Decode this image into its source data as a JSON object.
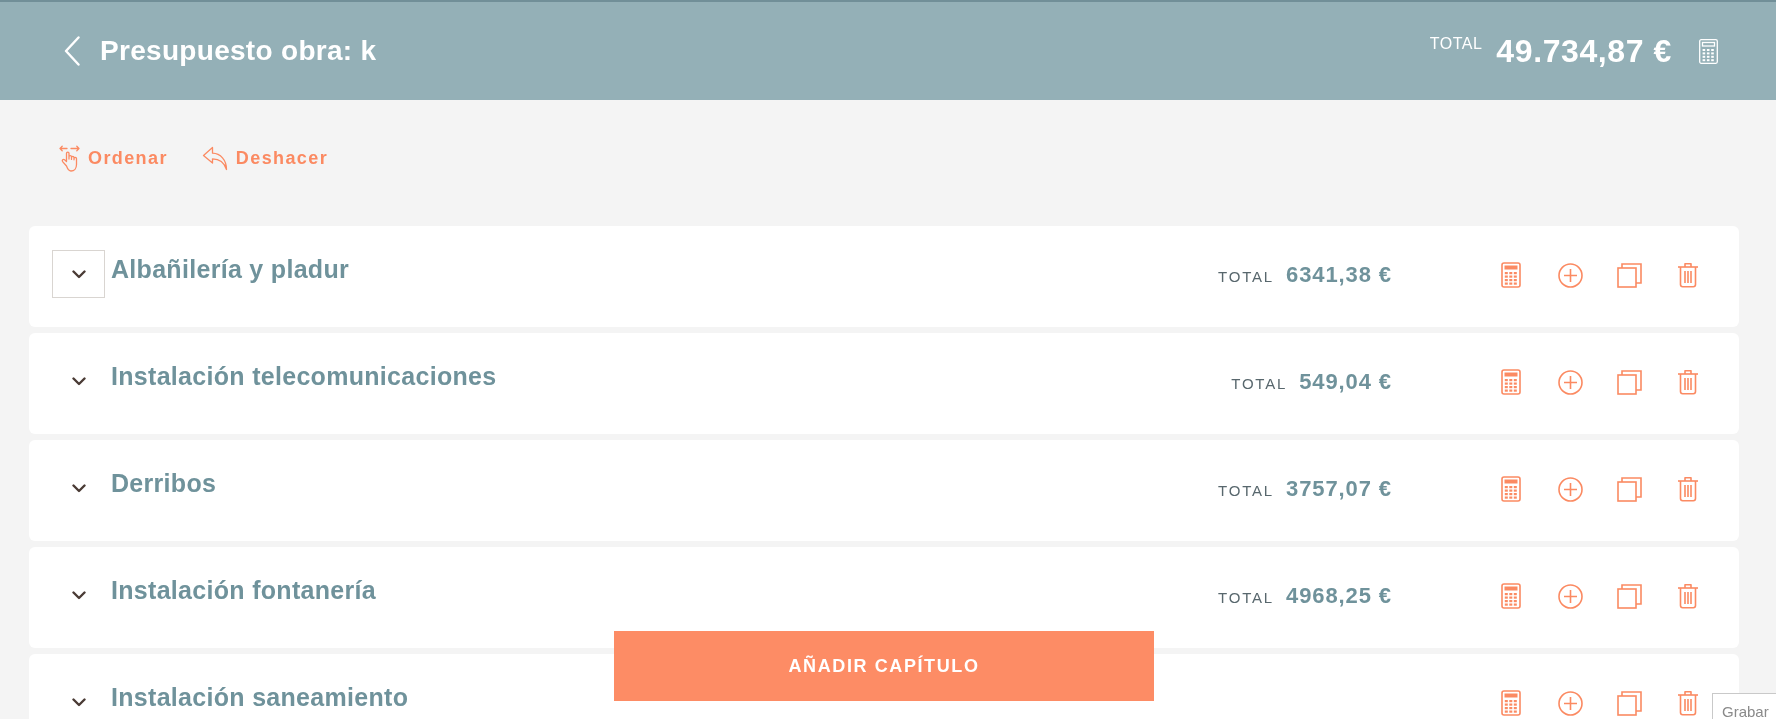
{
  "header": {
    "title": "Presupuesto obra: k",
    "total_label": "TOTAL",
    "total": "49.734,87 €"
  },
  "toolbar": [
    {
      "kind": "sort",
      "label": "Ordenar"
    },
    {
      "kind": "undo",
      "label": "Deshacer"
    }
  ],
  "chapters": [
    {
      "name": "Albañilería y pladur",
      "total_label": "TOTAL",
      "total": "6341,38 €",
      "focused": true
    },
    {
      "name": "Instalación telecomunicaciones",
      "total_label": "TOTAL",
      "total": "549,04 €",
      "focused": false
    },
    {
      "name": "Derribos",
      "total_label": "TOTAL",
      "total": "3757,07 €",
      "focused": false
    },
    {
      "name": "Instalación fontanería",
      "total_label": "TOTAL",
      "total": "4968,25 €",
      "focused": false
    },
    {
      "name": "Instalación saneamiento",
      "focused": false
    }
  ],
  "add_chapter_button": "AÑADIR CAPÍTULO",
  "tooltip": "Grabar"
}
